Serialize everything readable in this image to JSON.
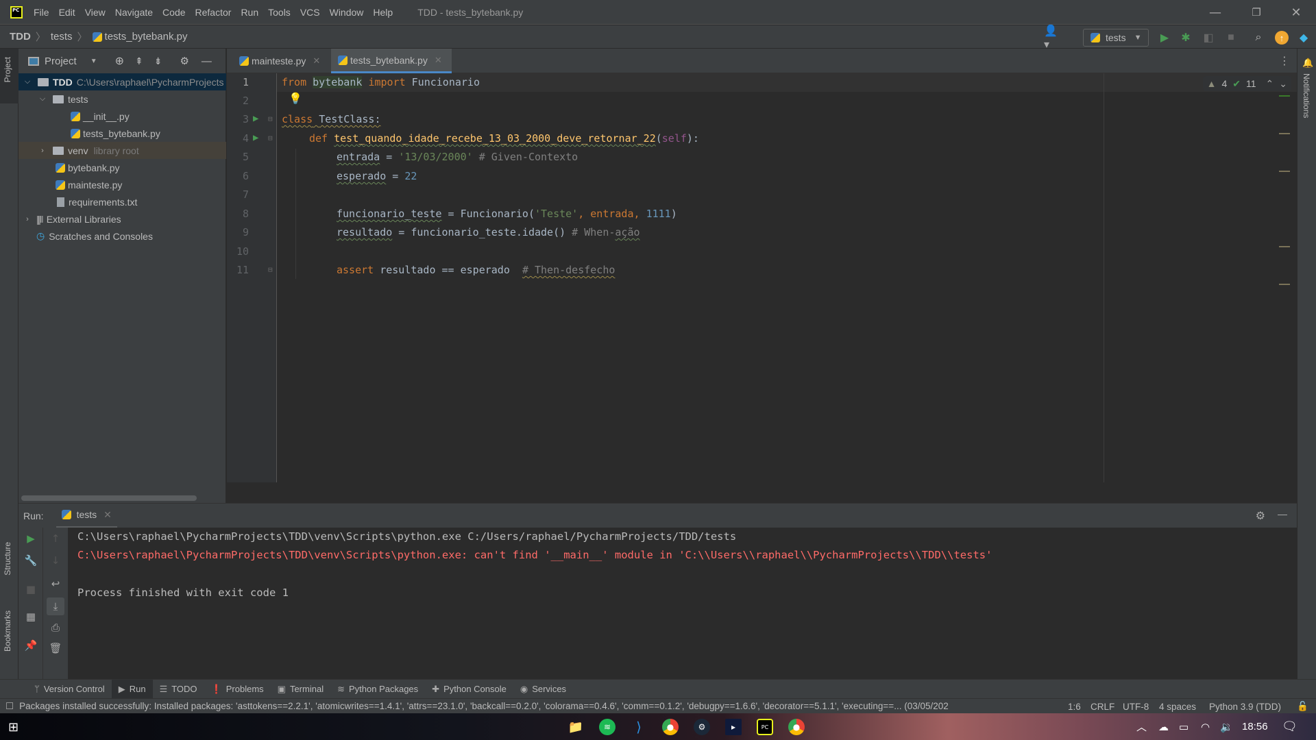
{
  "app": {
    "logo_text": "PC",
    "menu": [
      "File",
      "Edit",
      "View",
      "Navigate",
      "Code",
      "Refactor",
      "Run",
      "Tools",
      "VCS",
      "Window",
      "Help"
    ],
    "window_title": "TDD - tests_bytebank.py",
    "window_controls": {
      "minimize": "—",
      "restore": "❐",
      "close": "✕"
    }
  },
  "navbar": {
    "breadcrumb": [
      "TDD",
      "tests",
      "tests_bytebank.py"
    ],
    "run_config": "tests",
    "colors": {
      "run": "#499c54",
      "debug": "#499c54",
      "update": "#f0a732"
    }
  },
  "left_strip": {
    "project_label": "Project",
    "structure_label": "Structure",
    "bookmarks_label": "Bookmarks"
  },
  "right_strip": {
    "notifications_label": "Notifications"
  },
  "project": {
    "header": "Project",
    "tree": [
      {
        "label": "TDD",
        "hint": "C:\\Users\\raphael\\PycharmProjects",
        "type": "root-folder",
        "expanded": true
      },
      {
        "label": "tests",
        "type": "package",
        "expanded": true
      },
      {
        "label": "__init__.py",
        "type": "python"
      },
      {
        "label": "tests_bytebank.py",
        "type": "python"
      },
      {
        "label": "venv",
        "hint": "library root",
        "type": "folder",
        "expanded": false
      },
      {
        "label": "bytebank.py",
        "type": "python"
      },
      {
        "label": "mainteste.py",
        "type": "python"
      },
      {
        "label": "requirements.txt",
        "type": "text"
      },
      {
        "label": "External Libraries",
        "type": "libraries",
        "expanded": false
      },
      {
        "label": "Scratches and Consoles",
        "type": "scratches"
      }
    ]
  },
  "editor": {
    "tabs": [
      {
        "label": "mainteste.py",
        "active": false
      },
      {
        "label": "tests_bytebank.py",
        "active": true
      }
    ],
    "inspections": {
      "warnings": "4",
      "weak_warnings": "11"
    },
    "line_numbers": [
      "1",
      "2",
      "3",
      "4",
      "5",
      "6",
      "7",
      "8",
      "9",
      "10",
      "11"
    ],
    "code": {
      "l1": {
        "kw1": "from",
        "mod": "bytebank",
        "kw2": "import",
        "name": " Funcionario"
      },
      "l3": {
        "kw": "class",
        "name": "TestClass:"
      },
      "l4": {
        "kw": "def",
        "fn": "test_quando_idade_recebe_13_03_2000_deve_retornar_22",
        "p1": "(",
        "self": "self",
        "p2": "):"
      },
      "l5": {
        "var": "entrada",
        "op": " = ",
        "str": "'13/03/2000'",
        "cm": " # Given-Contexto"
      },
      "l6": {
        "var": "esperado",
        "op": " = ",
        "num": "22"
      },
      "l8": {
        "var": "funcionario_teste",
        "op": " = Funcionario(",
        "str": "'Teste'",
        "c1": ", entrada, ",
        "num": "1111",
        "end": ")"
      },
      "l9": {
        "var": "resultado",
        "op": " = funcionario_teste.idade()",
        "cm1": " # When-",
        "cm2": "ação"
      },
      "l11": {
        "kw": "assert",
        "rest": " resultado == esperado  ",
        "cm": "# Then-desfecho"
      }
    }
  },
  "run": {
    "label": "Run:",
    "tab": "tests",
    "output": [
      {
        "text": "C:\\Users\\raphael\\PycharmProjects\\TDD\\venv\\Scripts\\python.exe C:/Users/raphael/PycharmProjects/TDD/tests",
        "type": "normal"
      },
      {
        "text": "C:\\Users\\raphael\\PycharmProjects\\TDD\\venv\\Scripts\\python.exe: can't find '__main__' module in 'C:\\\\Users\\\\raphael\\\\PycharmProjects\\\\TDD\\\\tests'",
        "type": "error"
      },
      {
        "text": "",
        "type": "normal"
      },
      {
        "text": "Process finished with exit code 1",
        "type": "normal"
      }
    ]
  },
  "tool_tabs": [
    "Version Control",
    "Run",
    "TODO",
    "Problems",
    "Terminal",
    "Python Packages",
    "Python Console",
    "Services"
  ],
  "status": {
    "message": "Packages installed successfully: Installed packages: 'asttokens==2.2.1', 'atomicwrites==1.4.1', 'attrs==23.1.0', 'backcall==0.2.0', 'colorama==0.4.6', 'comm==0.1.2', 'debugpy==1.6.6', 'decorator==5.1.1', 'executing==... (03/05/202",
    "position": "1:6",
    "line_sep": "CRLF",
    "encoding": "UTF-8",
    "indent": "4 spaces",
    "interpreter": "Python 3.9 (TDD)"
  },
  "taskbar": {
    "apps": [
      "file-explorer",
      "spotify",
      "vscode",
      "chrome",
      "steam",
      "prime-video",
      "pycharm",
      "chrome-profile"
    ],
    "clock": "18:56"
  }
}
